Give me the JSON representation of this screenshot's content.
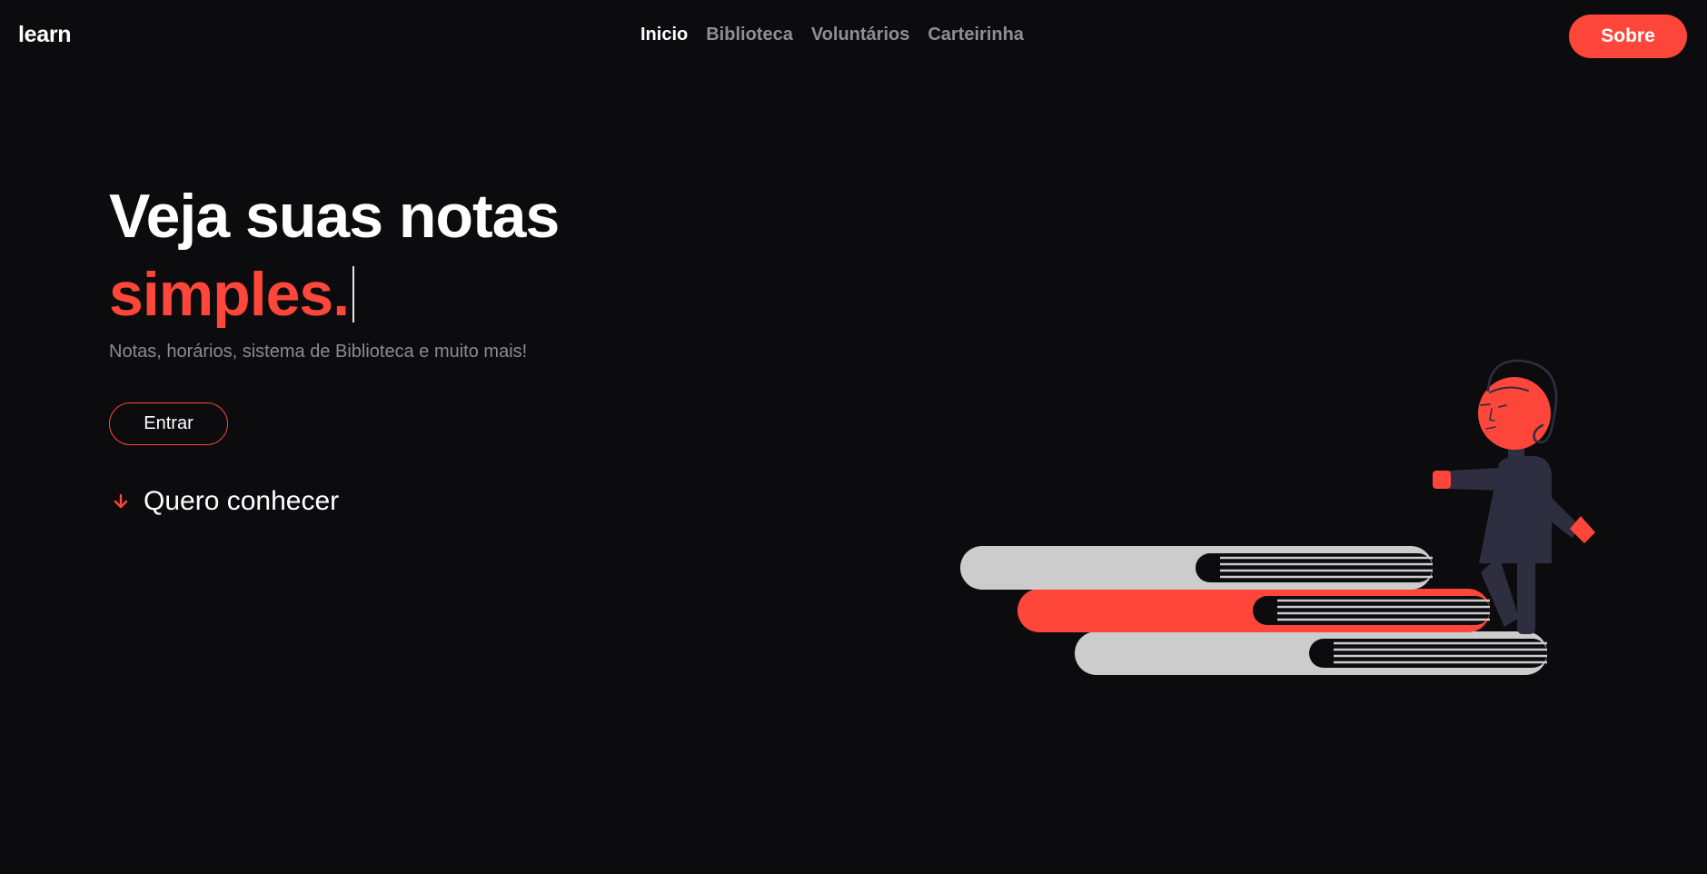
{
  "header": {
    "logo": "learn",
    "nav": [
      {
        "label": "Inicio",
        "active": true
      },
      {
        "label": "Biblioteca",
        "active": false
      },
      {
        "label": "Voluntários",
        "active": false
      },
      {
        "label": "Carteirinha",
        "active": false
      }
    ],
    "cta_label": "Sobre"
  },
  "hero": {
    "title_line1": "Veja suas notas",
    "title_line2": "simples.",
    "subtitle": "Notas, horários, sistema de Biblioteca e muito mais!",
    "primary_button": "Entrar",
    "secondary_link": "Quero conhecer"
  },
  "colors": {
    "background": "#0c0c0e",
    "accent": "#ff463a",
    "muted_text": "#8a8a92",
    "book_gray": "#cccccc",
    "figure_dark": "#2f2e41"
  },
  "icons": {
    "conhecer_icon": "arrow-down-icon"
  }
}
